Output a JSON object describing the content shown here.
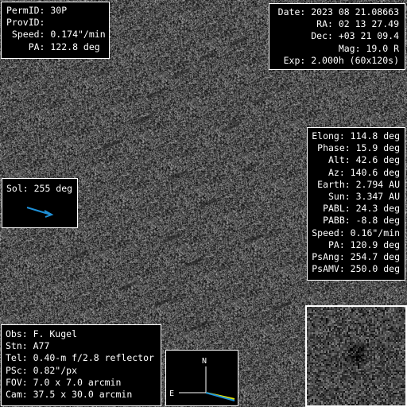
{
  "top_left": {
    "lines": [
      "PermID: 30P",
      "ProvID:",
      " Speed: 0.174\"/min",
      "    PA: 122.8 deg"
    ]
  },
  "top_right": {
    "lines": [
      "Date: 2023 08 21.08663",
      "RA: 02 13 27.49",
      "Dec: +03 21 09.4",
      "Mag: 19.0 R",
      "Exp: 2.000h (60x120s)"
    ]
  },
  "ephemeris": {
    "lines": [
      "Elong: 114.8 deg",
      "Phase: 15.9 deg",
      "Alt: 42.6 deg",
      "Az: 140.6 deg",
      "Earth: 2.794 AU",
      "Sun: 3.347 AU",
      "PABL: 24.3 deg",
      "PABB: -8.8 deg",
      "Speed: 0.16\"/min",
      "PA: 120.9 deg",
      "PsAng: 254.7 deg",
      "PsAMV: 250.0 deg"
    ]
  },
  "sol": {
    "label": "Sol: 255 deg",
    "arrow_color": "#1e90d8",
    "arrow_angle_deg": 255
  },
  "observer": {
    "lines": [
      "Obs: F. Kugel",
      "Stn: A77",
      "Tel: 0.40-m f/2.8 reflector",
      "PSc: 0.82\"/px",
      "FOV: 7.0 x 7.0 arcmin",
      "Cam: 37.5 x 30.0 arcmin"
    ]
  },
  "compass": {
    "north_label": "N",
    "east_label": "E",
    "motion_color": "#1e90d8",
    "pa_color": "#e8e800"
  },
  "image": {
    "background_color": "#555555",
    "trail_color": "#1e1e1e"
  }
}
